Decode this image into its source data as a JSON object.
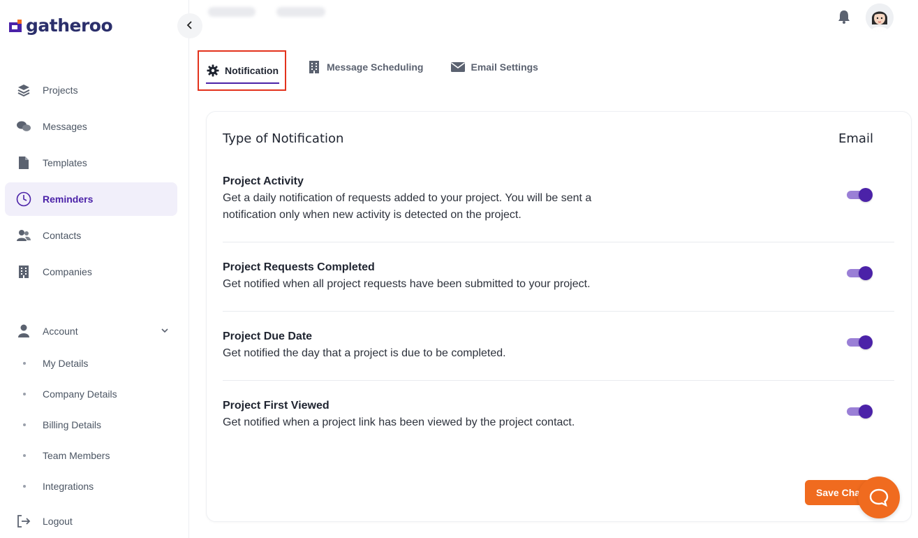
{
  "app": {
    "logo_text": "gatheroo",
    "brand_color": "#4b22a8",
    "accent_color": "#f06b1f"
  },
  "sidebar": {
    "collapse_icon": "chevron-left-icon",
    "items": [
      {
        "label": "Projects",
        "icon": "layers-icon",
        "active": false
      },
      {
        "label": "Messages",
        "icon": "chat-icon",
        "active": false
      },
      {
        "label": "Templates",
        "icon": "document-icon",
        "active": false
      },
      {
        "label": "Reminders",
        "icon": "clock-icon",
        "active": true
      },
      {
        "label": "Contacts",
        "icon": "users-icon",
        "active": false
      },
      {
        "label": "Companies",
        "icon": "building-icon",
        "active": false
      }
    ],
    "account": {
      "label": "Account",
      "icon": "user-icon",
      "sub_items": [
        "My Details",
        "Company Details",
        "Billing Details",
        "Team Members",
        "Integrations"
      ]
    },
    "logout_label": "Logout"
  },
  "header": {
    "bell_icon": "bell-icon",
    "avatar": "user-avatar"
  },
  "tabs": [
    {
      "label": "Notification",
      "icon": "gear-icon",
      "active": true
    },
    {
      "label": "Message Scheduling",
      "icon": "building-icon",
      "active": false
    },
    {
      "label": "Email Settings",
      "icon": "envelope-icon",
      "active": false
    }
  ],
  "card": {
    "header_type": "Type of Notification",
    "header_email": "Email",
    "rows": [
      {
        "title": "Project Activity",
        "description": "Get a daily notification of requests added to your project. You will be sent a notification only when new activity is detected on the project.",
        "email_enabled": true
      },
      {
        "title": "Project Requests Completed",
        "description": "Get notified when all project requests have been submitted to your project.",
        "email_enabled": true
      },
      {
        "title": "Project Due Date",
        "description": "Get notified the day that a project is due to be completed.",
        "email_enabled": true
      },
      {
        "title": "Project First Viewed",
        "description": "Get notified when a project link has been viewed by the project contact.",
        "email_enabled": true
      }
    ]
  },
  "save_button": {
    "label": "Save Cha"
  },
  "chat": {
    "icon": "chat-bubble-icon"
  }
}
